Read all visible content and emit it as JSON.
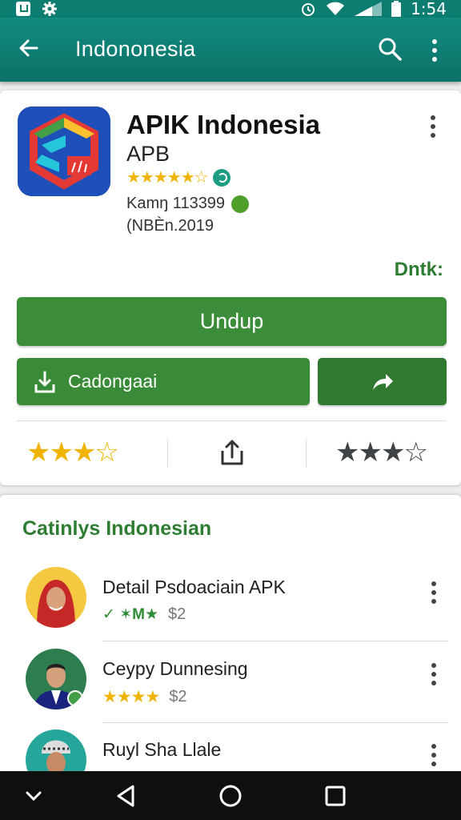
{
  "status_bar": {
    "time": "1:54",
    "icons": [
      "notification-icon",
      "settings-icon",
      "alarm-icon",
      "wifi-icon",
      "signal-icon",
      "battery-icon"
    ]
  },
  "toolbar": {
    "title": "Indononesia",
    "icons": [
      "back-arrow-icon",
      "search-icon",
      "more-vert-icon"
    ]
  },
  "app": {
    "name": "APIK Indonesia",
    "developer": "APB",
    "rating_stars": "★★★★★☆",
    "meta1": "Kamŋ 113399",
    "meta2": "(NBЀn.2019",
    "price_label": "Dntk:",
    "install_label": "Undup",
    "download_label": "Cadongaai",
    "left_stars": "★★★☆",
    "right_stars": "★★★☆"
  },
  "section": {
    "title": "Catinlys Indonesian",
    "items": [
      {
        "name": "Detail Psdoaciain APK",
        "badges": "✓ ✶M★",
        "price": "$2"
      },
      {
        "name": "Ceypy Dunnesing",
        "stars": "★★★★",
        "price": "$2"
      },
      {
        "name": "Ruyl Sha Llale"
      }
    ]
  },
  "colors": {
    "primary": "#0d7d72",
    "accent_green": "#3c8d3a",
    "star": "#f0b400"
  }
}
